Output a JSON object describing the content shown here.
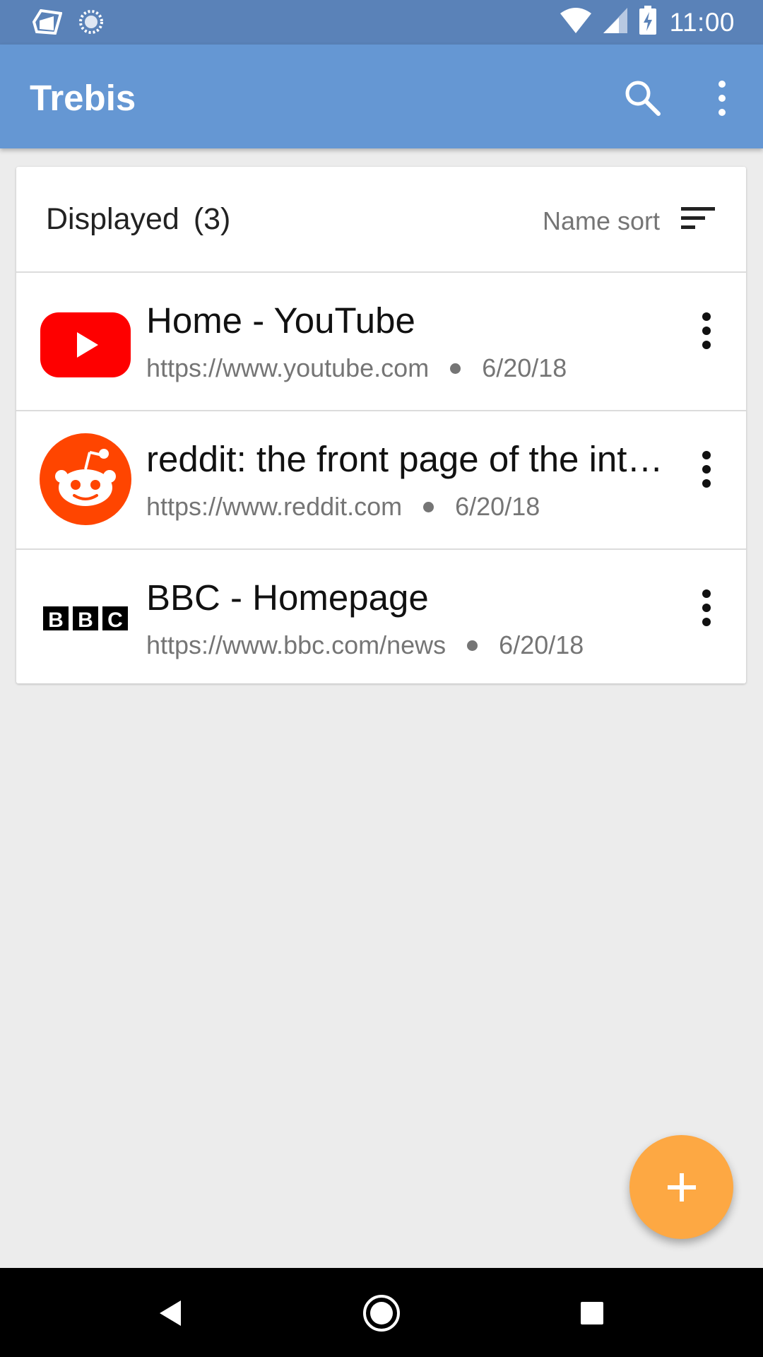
{
  "status_bar": {
    "time": "11:00",
    "icons": [
      "notification-app-icon",
      "notification-loading-icon",
      "wifi-icon",
      "cell-signal-icon",
      "battery-charging-icon"
    ]
  },
  "app_bar": {
    "title": "Trebis",
    "actions": [
      "search-icon",
      "more-vert-icon"
    ]
  },
  "list": {
    "heading": "Displayed",
    "count": "(3)",
    "sort_label": "Name sort",
    "items": [
      {
        "title": "Home - YouTube",
        "url": "https://www.youtube.com",
        "date": "6/20/18",
        "favicon": "youtube-favicon"
      },
      {
        "title": "reddit: the front page of the internet",
        "url": "https://www.reddit.com",
        "date": "6/20/18",
        "favicon": "reddit-favicon"
      },
      {
        "title": "BBC - Homepage",
        "url": "https://www.bbc.com/news",
        "date": "6/20/18",
        "favicon": "bbc-favicon"
      }
    ]
  },
  "fab": {
    "icon": "add-icon"
  },
  "nav_bar": {
    "buttons": [
      "back-icon",
      "home-icon",
      "recents-icon"
    ]
  },
  "colors": {
    "status_bar": "#5a82b8",
    "app_bar": "#6597d3",
    "fab": "#fda843",
    "background": "#ececec"
  }
}
